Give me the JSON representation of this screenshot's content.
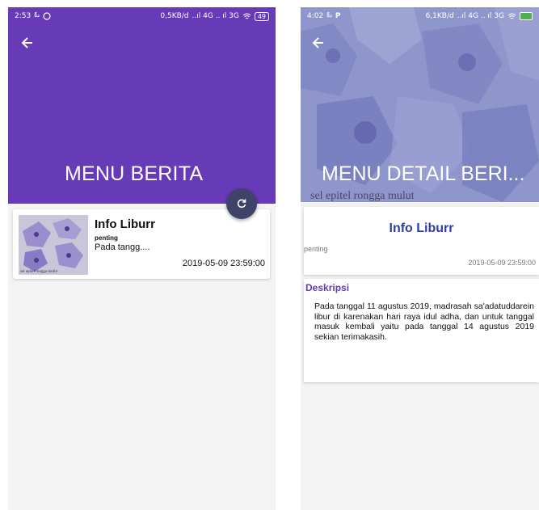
{
  "left_screen": {
    "status": {
      "time": "2:53",
      "network": "0,5KB/d",
      "indicators": "..ıl 4G .. ıl 3G",
      "battery": "49"
    },
    "appbar": {
      "title": "MENU BERITA"
    },
    "news_item": {
      "title": "Info Liburr",
      "tag": "penting",
      "preview": "Pada tangg....",
      "date": "2019-05-09 23:59:00",
      "thumb_caption": "sel epitel rongga mulut"
    }
  },
  "right_screen": {
    "status": {
      "time": "4:02",
      "network": "6,1KB/d",
      "indicators": "..ıl 4G .. ıl 3G",
      "battery": ""
    },
    "header": {
      "title": "MENU DETAIL BERI...",
      "caption": "sel epitel rongga mulut"
    },
    "detail": {
      "title": "Info Liburr",
      "tag": "penting",
      "date": "2019-05-09 23:59:00"
    },
    "description": {
      "heading": "Deskripsi",
      "body": "Pada tanggal 11 agustus 2019, madrasah sa'adatuddarein libur di karenakan hari raya idul adha, dan untuk tanggal masuk kembali yaitu pada tanggal 14 agustus 2019 sekian terimakasih."
    }
  },
  "colors": {
    "primary": "#673ab7",
    "fab": "#3f4369",
    "detail_title": "#303f9f"
  },
  "icons": [
    "arrow-left-icon",
    "refresh-icon",
    "whatsapp-icon",
    "wifi-icon",
    "battery-icon"
  ]
}
